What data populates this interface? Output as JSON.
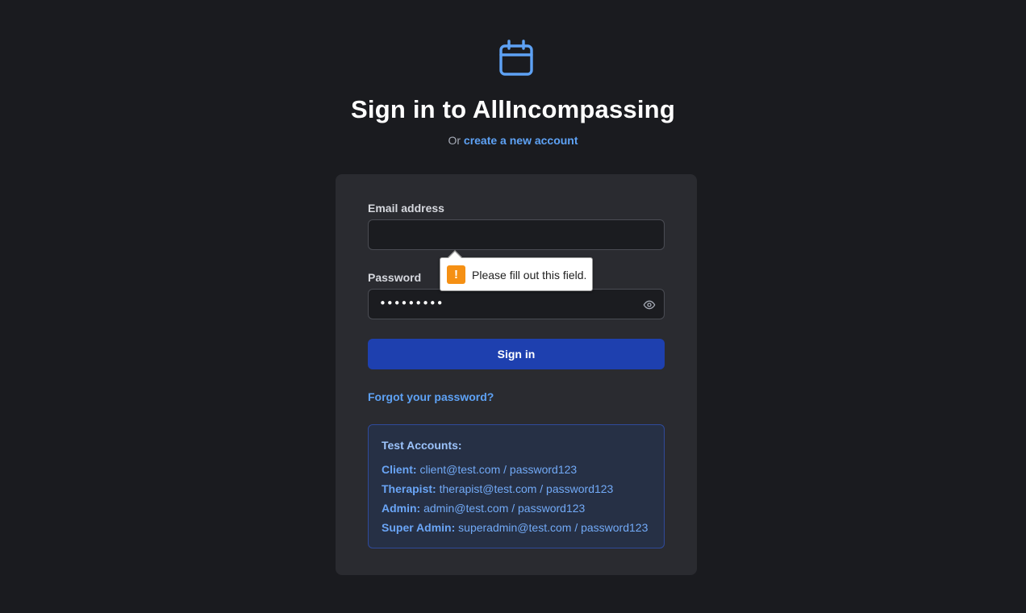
{
  "header": {
    "logo_icon": "calendar-icon",
    "title": "Sign in to AllIncompassing",
    "subtitle_prefix": "Or",
    "create_account_link": "create a new account"
  },
  "form": {
    "email_label": "Email address",
    "email_value": "",
    "password_label": "Password",
    "password_masked": "•••••••••",
    "toggle_visibility_icon": "eye-icon",
    "signin_label": "Sign in",
    "forgot_link": "Forgot your password?"
  },
  "validation_tooltip": {
    "icon": "warning-icon",
    "glyph": "!",
    "message": "Please fill out this field."
  },
  "test_accounts": {
    "title": "Test Accounts:",
    "rows": [
      {
        "role": "Client:",
        "creds": "client@test.com / password123"
      },
      {
        "role": "Therapist:",
        "creds": "therapist@test.com / password123"
      },
      {
        "role": "Admin:",
        "creds": "admin@test.com / password123"
      },
      {
        "role": "Super Admin:",
        "creds": "superadmin@test.com / password123"
      }
    ]
  },
  "colors": {
    "background": "#1a1b1f",
    "card": "#2a2b30",
    "accent_link": "#5ea2f5",
    "button": "#1e40af",
    "warning": "#f59014"
  }
}
